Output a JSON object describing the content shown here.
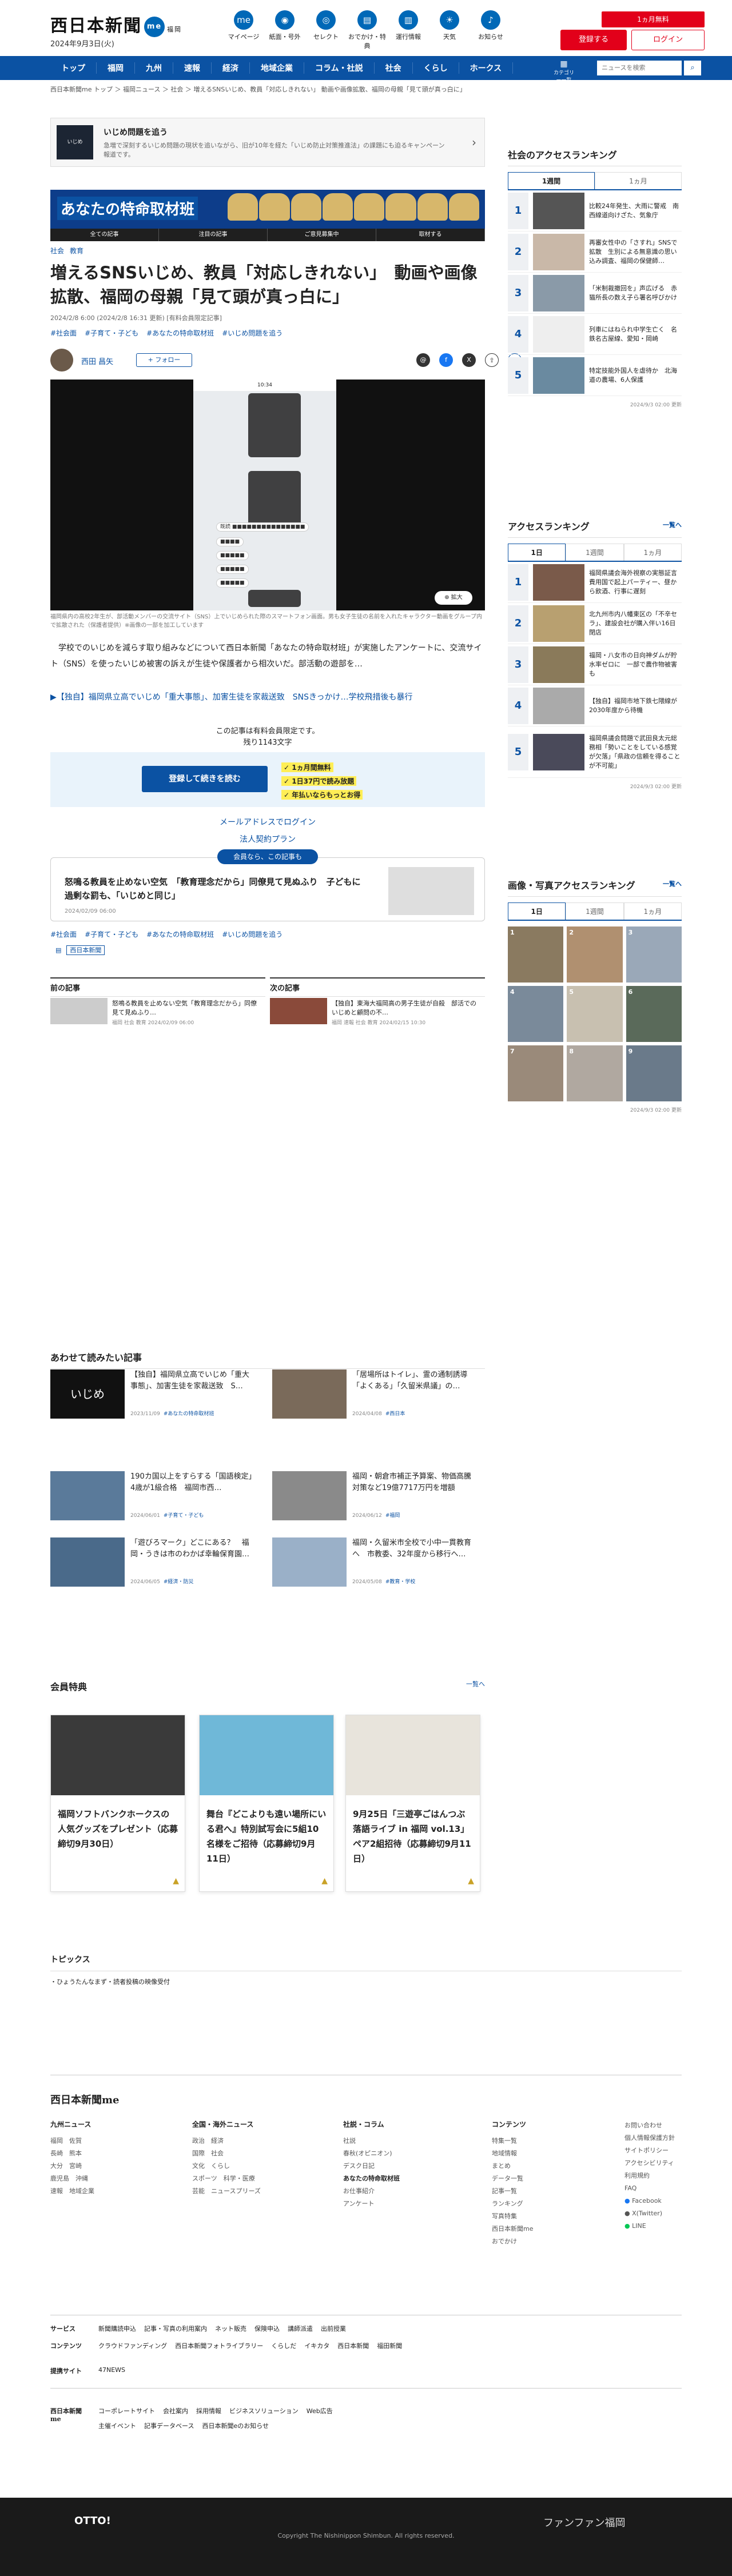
{
  "header": {
    "logo": "西日本新聞",
    "logo_badge": "me",
    "logo_sub": "福岡",
    "date": "2024年9月3日(火)",
    "icons": [
      {
        "label": "マイページ",
        "icon": "me-icon"
      },
      {
        "label": "紙面・号外",
        "icon": "newspaper-icon"
      },
      {
        "label": "セレクト",
        "icon": "select-icon"
      },
      {
        "label": "おでかけ・特典",
        "icon": "ticket-icon"
      },
      {
        "label": "運行情報",
        "icon": "train-icon"
      },
      {
        "label": "天気",
        "icon": "weather-icon"
      },
      {
        "label": "お知らせ",
        "icon": "bell-icon"
      }
    ],
    "subscribe": "1ヵ月無料",
    "register": "登録する",
    "login": "ログイン"
  },
  "nav": {
    "items": [
      "トップ",
      "福岡",
      "九州",
      "速報",
      "経済",
      "地域企業",
      "コラム・社説",
      "社会",
      "くらし",
      "ホークス"
    ],
    "category": "カテゴリー一覧",
    "search_placeholder": "ニュースを検索"
  },
  "breadcrumb": "西日本新聞me トップ ＞ 福岡ニュース ＞ 社会 ＞ 増えるSNSいじめ、教員「対応しきれない」 動画や画像拡散、福岡の母親「見て頭が真っ白に」",
  "ijime_box": {
    "thumb": "いじめ",
    "title": "いじめ問題を追う",
    "desc": "急増で深刻するいじめ問題の現状を追いながら、旧が10年を経た「いじめ防止対策推進法」の課題にも迫るキャンペーン報道です。"
  },
  "banner": {
    "title": "あなたの特命取材班",
    "menu": [
      "全ての記事",
      "注目の記事",
      "ご意見募集中",
      "取材する"
    ]
  },
  "article": {
    "categories": [
      "社会",
      "教育"
    ],
    "title": "増えるSNSいじめ、教員「対応しきれない」　動画や画像拡散、福岡の母親「見て頭が真っ白に」",
    "meta": "2024/2/8 6:00 (2024/2/8 16:31 更新) [有料会員限定記事]",
    "tags": [
      "#社会面",
      "#子育て・子ども",
      "#あなたの特命取材班",
      "#いじめ問題を追う"
    ],
    "author": "西田 昌矢",
    "follow": "+ フォロー",
    "share": [
      "threads",
      "facebook",
      "x",
      "share",
      "bookmark"
    ],
    "phone_bubbles": [
      "既読 ■■■■■■■■■■■■■■■",
      "■■■■",
      "■■■■■",
      "■■■■■",
      "■■■■■"
    ],
    "zoom": "拡大",
    "caption": "福岡県内の高校2年生が、部活動メンバーの交流サイト（SNS）上でいじめられた際のスマートフォン画面。男も女子生徒の名前を入れたキャラクター動画をグループ内で拡散された（保護者提供）※画像の一部を加工しています",
    "body": "　学校でのいじめを減らす取り組みなどについて西日本新聞「あなたの特命取材班」が実施したアンケートに、交流サイト（SNS）を使ったいじめ被害の訴えが生徒や保護者から相次いだ。部活動の遊部を…",
    "related": "▶【独自】福岡県立高でいじめ「重大事態」、加害生徒を家裁送致　SNSきっかけ…学校飛措後も暴行",
    "paywall1": "この記事は有料会員限定です。",
    "paywall2": "残り1143文字",
    "pay_button": "登録して続きを読む",
    "perks": [
      "1ヵ月間無料",
      "1日37円で読み放題",
      "年払いならもっとお得"
    ],
    "mail_login": "メールアドレスでログイン",
    "corp": "法人契約プラン",
    "pill": "会員なら、この記事も",
    "rec_title": "怒鳴る教員を止めない空気　「教育理念だから」同僚見て見ぬふり　子どもに過剰な罰も、「いじめと同じ」",
    "rec_date": "2024/02/09 06:00",
    "source_label": "西日本新聞",
    "prev": {
      "label": "前の記事",
      "title": "怒鳴る教員を止めない空気「教育理念だから」同僚見て見ぬふり…",
      "date": "福岡 社会 教育 2024/02/09 06:00"
    },
    "next": {
      "label": "次の記事",
      "title": "【独自】東海大福岡高の男子生徒が自殺　部活でのいじめと顧問の不…",
      "date": "福岡 速報 社会 教育 2024/02/15 10:30"
    }
  },
  "read_together": {
    "heading": "あわせて読みたい記事",
    "items": [
      {
        "title": "【独自】福岡県立高でいじめ「重大事態」、加害生徒を家裁送致　S…",
        "date": "2023/11/09",
        "tag": "#あなたの特命取材班",
        "img": "いじめ"
      },
      {
        "title": "「居場所はトイレ」、霊の通制誘導「よくある」「久留米県議」の…",
        "date": "2024/04/08",
        "tag": "#西日本"
      },
      {
        "title": "190カ国以上をすらする「国語検定」4歳が1級合格　福岡市西…",
        "date": "2024/06/01",
        "tag": "#子育て・子ども"
      },
      {
        "title": "福岡・朝倉市補正予算案、物価高騰対策など19億7717万円を増額",
        "date": "2024/06/12",
        "tag": "#福岡"
      },
      {
        "title": "「遊びろマーク」どこにある？　福岡・うきは市のわかば幸輪保育園…",
        "date": "2024/06/05",
        "tag": "#経済・防災"
      },
      {
        "title": "福岡・久留米市全校で小中一貫教育へ　市教委、32年度から移行へ…",
        "date": "2024/05/08",
        "tag": "#教育・学校"
      }
    ]
  },
  "members": {
    "heading": "会員特典",
    "more": "一覧へ",
    "items": [
      {
        "title": "福岡ソフトバンクホークスの人気グッズをプレゼント（応募締切9月30日）"
      },
      {
        "title": "舞台『どこよりも遠い場所にいる君へ』特別試写会に5組10名様をご招待（応募締切9月11日）"
      },
      {
        "title": "9月25日「三遊亭ごはんつぶ落語ライブ in 福岡 vol.13」ペア2組招待（応募締切9月11日）"
      }
    ]
  },
  "topics": {
    "heading": "トピックス",
    "items": [
      "・ひょうたんなまず・読者投稿の映像受付"
    ]
  },
  "sidebar": {
    "social": {
      "heading": "社会のアクセスランキング",
      "tabs": [
        "1週間",
        "1ヵ月"
      ],
      "items": [
        {
          "n": "1",
          "t": "比較24年発生、大雨に警戒　南西線道向けざた、気象庁"
        },
        {
          "n": "2",
          "t": "再審女性中の「さすれ」SNSで拡散　生別による無意識の思い込み調査、福岡の保健師…"
        },
        {
          "n": "3",
          "t": "「米制裁撤回を」声広げる　赤猫所長の数え子ら署名呼びかけ"
        },
        {
          "n": "4",
          "t": "列車にはねられ中学生亡く　名鉄名古屋線、愛知・岡崎"
        },
        {
          "n": "5",
          "t": "特定技能外国人を虐待か　北海道の農場、6人保護"
        }
      ],
      "date": "2024/9/3 02:00 更新"
    },
    "access": {
      "heading": "アクセスランキング",
      "more": "一覧へ",
      "tabs": [
        "1日",
        "1週間",
        "1ヵ月"
      ],
      "items": [
        {
          "n": "1",
          "t": "福岡県議会海外視察の実態証言　費用国で起上パーティー、昼から飲酒、行事に遅刻"
        },
        {
          "n": "2",
          "t": "北九州市内八幡東区の「不辛セラ」、建設会社が購入伴い16日閉店"
        },
        {
          "n": "3",
          "t": "福岡・八女市の日向神ダムが貯水率ゼロに　一部で農作物被害も"
        },
        {
          "n": "4",
          "t": "【独自】福岡市地下鉄七隈線が2030年度から待機"
        },
        {
          "n": "5",
          "t": "福岡県議会問題で武田良太元総務相「勢いことをしている感覚が欠落」「県政の信頼を得ることが不可能」"
        }
      ],
      "date": "2024/9/3 02:00 更新"
    },
    "photo": {
      "heading": "画像・写真アクセスランキング",
      "more": "一覧へ",
      "tabs": [
        "1日",
        "1週間",
        "1ヵ月"
      ],
      "nums": [
        "1",
        "2",
        "3",
        "4",
        "5",
        "6",
        "7",
        "8",
        "9"
      ],
      "date": "2024/9/3 02:00 更新"
    }
  },
  "footer": {
    "logo": "西日本新聞me",
    "cols": [
      {
        "h": "九州ニュース",
        "items": [
          "福岡",
          "佐賀",
          "長崎",
          "熊本",
          "大分",
          "宮崎",
          "鹿児島",
          "沖縄",
          "速報",
          "地域企業"
        ]
      },
      {
        "h": "全国・海外ニュース",
        "items": [
          "政治",
          "経済",
          "国際",
          "社会",
          "文化",
          "くらし",
          "スポーツ",
          "科学・医療",
          "芸能",
          "ニュースプリーズ"
        ]
      },
      {
        "h": "社説・コラム",
        "items": [
          "社説",
          "春秋(オピニオン)",
          "デスク日記",
          "あなたの特命取材班",
          "お仕事紹介",
          "アンケート"
        ]
      },
      {
        "h": "コンテンツ",
        "items": [
          "特集一覧",
          "地域情報",
          "まとめ",
          "データ一覧",
          "記事一覧",
          "ランキング",
          "写真特集",
          "西日本新聞me",
          "おでかけ"
        ]
      },
      {
        "h": "",
        "items": [
          "お問い合わせ",
          "個人情報保護方針",
          "サイトポリシー",
          "アクセシビリティ",
          "利用規約",
          "FAQ",
          "Facebook",
          "X(Twitter)",
          "LINE"
        ]
      }
    ],
    "service": {
      "h": "サービス",
      "items": [
        "新聞購読申込",
        "記事・写真の利用案内",
        "ネット販売",
        "保険申込",
        "講師派遣",
        "出前授業"
      ]
    },
    "contents": {
      "h": "コンテンツ",
      "items": [
        "クラウドファンディング",
        "西日本新聞フォトライブラリー",
        "くらしだ",
        "イキカタ",
        "西日本新聞",
        "福田新聞"
      ]
    },
    "partner": {
      "h": "提携サイト",
      "items": [
        "47NEWS"
      ]
    },
    "corp_links": [
      "コーポレートサイト",
      "会社案内",
      "採用情報",
      "ビジネスソリューション",
      "Web広告",
      "主催イベント",
      "記事データベース",
      "西日本新聞eのお知らせ"
    ],
    "copyright": "Copyright The Nishinippon Shimbun. All rights reserved.",
    "otto": "OTTO!",
    "fanfan": "ファンファン福岡"
  }
}
